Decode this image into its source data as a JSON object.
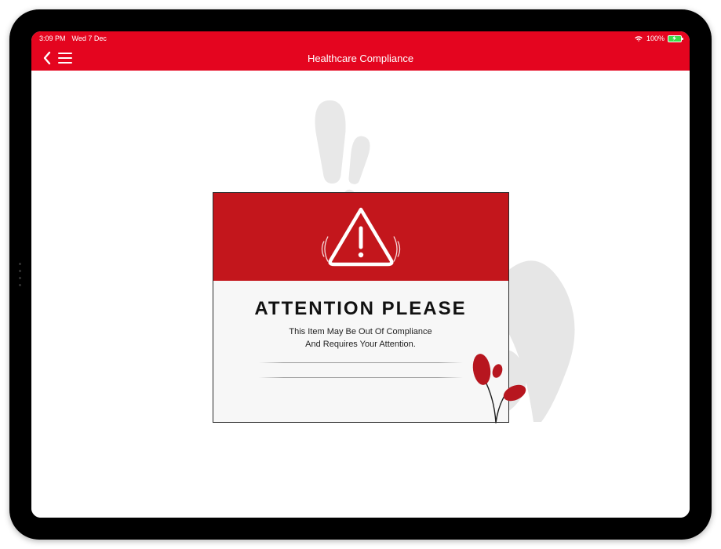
{
  "status": {
    "time": "3:09 PM",
    "date": "Wed 7 Dec",
    "battery_pct": "100%"
  },
  "header": {
    "title": "Healthcare Compliance"
  },
  "card": {
    "title": "ATTENTION PLEASE",
    "line1": "This Item May Be Out Of Compliance",
    "line2": "And Requires Your Attention."
  },
  "colors": {
    "brand": "#e4051f",
    "card_red": "#c3161c"
  }
}
